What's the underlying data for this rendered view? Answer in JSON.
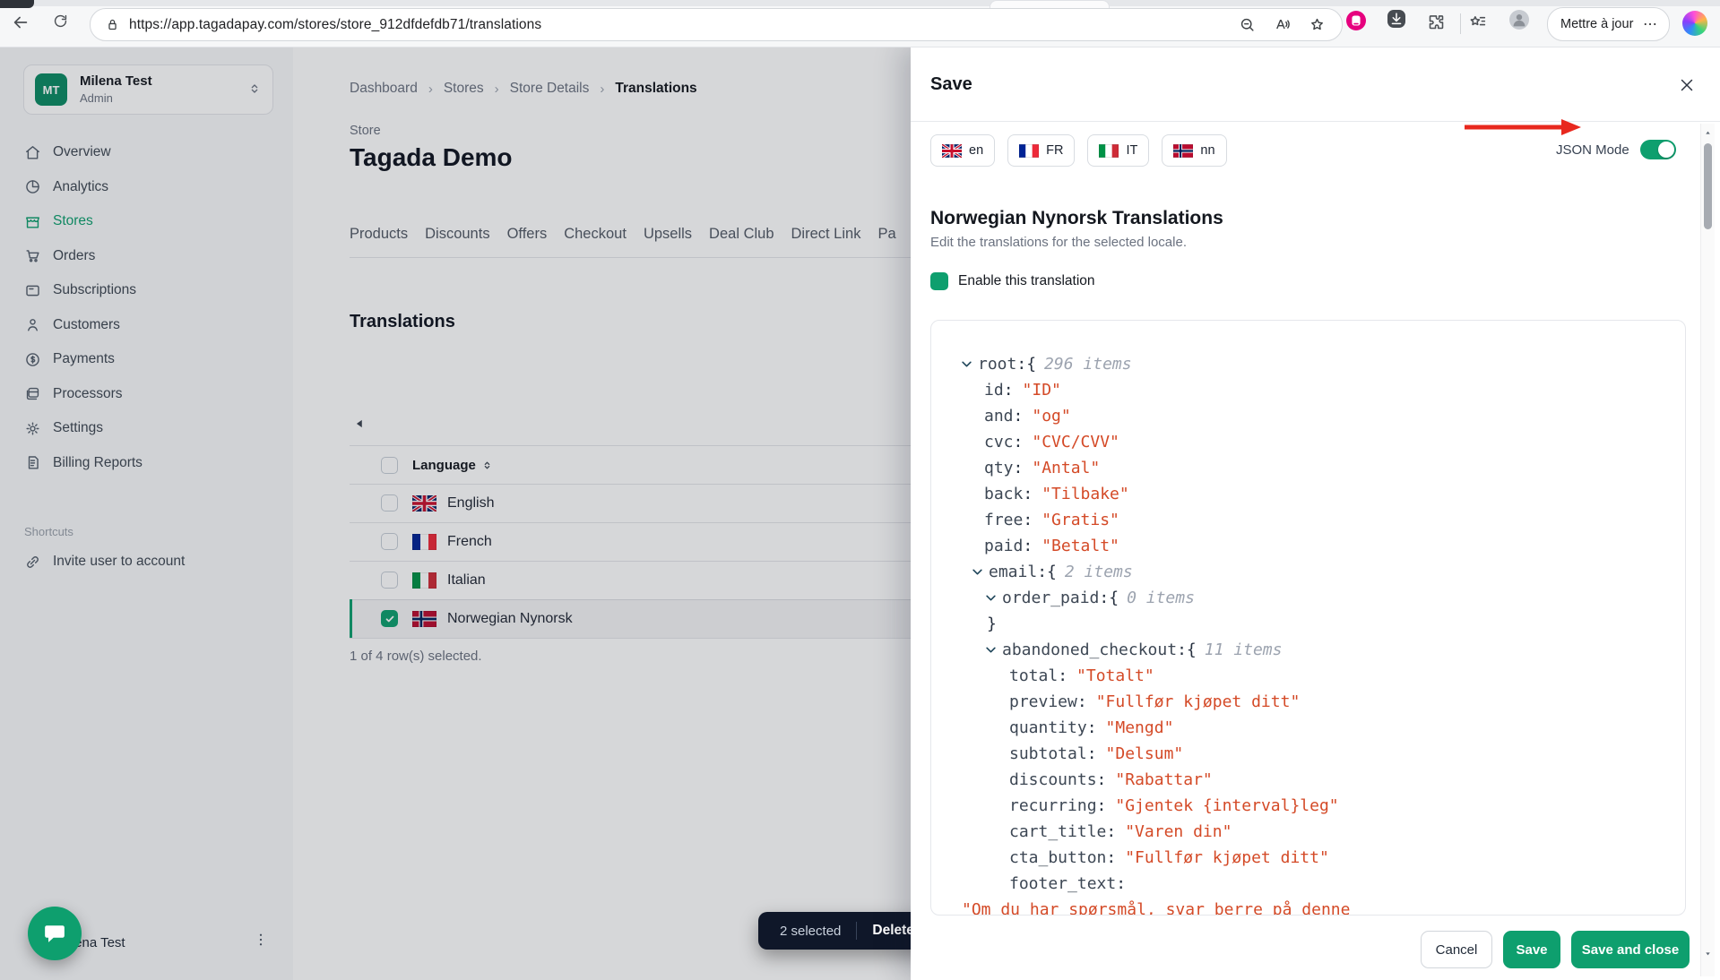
{
  "browser": {
    "url": "https://app.tagadapay.com/stores/store_912dfdefdb71/translations",
    "update_button": "Mettre à jour",
    "update_more": "…"
  },
  "sidebar": {
    "account": {
      "initials": "MT",
      "name": "Milena Test",
      "role": "Admin"
    },
    "nav": [
      {
        "icon": "home",
        "label": "Overview"
      },
      {
        "icon": "pie",
        "label": "Analytics"
      },
      {
        "icon": "store",
        "label": "Stores",
        "active": true
      },
      {
        "icon": "cart",
        "label": "Orders"
      },
      {
        "icon": "card",
        "label": "Subscriptions"
      },
      {
        "icon": "user",
        "label": "Customers"
      },
      {
        "icon": "dollar",
        "label": "Payments"
      },
      {
        "icon": "stack",
        "label": "Processors"
      },
      {
        "icon": "gear",
        "label": "Settings"
      },
      {
        "icon": "doc",
        "label": "Billing Reports"
      }
    ],
    "shortcuts_label": "Shortcuts",
    "shortcuts": [
      {
        "icon": "link",
        "label": "Invite user to account"
      }
    ],
    "footer_name": "Milena Test"
  },
  "main": {
    "breadcrumb": [
      "Dashboard",
      "Stores",
      "Store Details",
      "Translations"
    ],
    "store_label": "Store",
    "store_name": "Tagada Demo",
    "tabs": [
      "Products",
      "Discounts",
      "Offers",
      "Checkout",
      "Upsells",
      "Deal Club",
      "Direct Link",
      "Pa"
    ],
    "section_title": "Translations",
    "table": {
      "column": "Language",
      "rows": [
        {
          "flag": "uk",
          "label": "English",
          "checked": false,
          "selected": false
        },
        {
          "flag": "fr",
          "label": "French",
          "checked": false,
          "selected": false
        },
        {
          "flag": "it",
          "label": "Italian",
          "checked": false,
          "selected": false
        },
        {
          "flag": "no",
          "label": "Norwegian Nynorsk",
          "checked": true,
          "selected": true
        }
      ]
    },
    "selection_summary": "1 of 4 row(s) selected.",
    "toast": {
      "selected": "2 selected",
      "action": "Delete"
    }
  },
  "panel": {
    "title": "Save",
    "locales": [
      {
        "flag": "uk",
        "code": "en"
      },
      {
        "flag": "fr",
        "code": "FR"
      },
      {
        "flag": "it",
        "code": "IT"
      },
      {
        "flag": "no",
        "code": "nn"
      }
    ],
    "json_mode_label": "JSON Mode",
    "json_mode_on": true,
    "heading": "Norwegian Nynorsk Translations",
    "subheading": "Edit the translations for the selected locale.",
    "enable_label": "Enable this translation",
    "tree": [
      {
        "t": "open",
        "indent": 0,
        "key": "root",
        "count": "296 items"
      },
      {
        "t": "kv",
        "indent": 1,
        "key": "id",
        "value": "\"ID\""
      },
      {
        "t": "kv",
        "indent": 1,
        "key": "and",
        "value": "\"og\""
      },
      {
        "t": "kv",
        "indent": 1,
        "key": "cvc",
        "value": "\"CVC/CVV\""
      },
      {
        "t": "kv",
        "indent": 1,
        "key": "qty",
        "value": "\"Antal\""
      },
      {
        "t": "kv",
        "indent": 1,
        "key": "back",
        "value": "\"Tilbake\""
      },
      {
        "t": "kv",
        "indent": 1,
        "key": "free",
        "value": "\"Gratis\""
      },
      {
        "t": "kv",
        "indent": 1,
        "key": "paid",
        "value": "\"Betalt\""
      },
      {
        "t": "open",
        "indent": 1,
        "key": "email",
        "count": "2 items"
      },
      {
        "t": "open",
        "indent": 2,
        "key": "order_paid",
        "count": "0 items"
      },
      {
        "t": "close",
        "indent": 2
      },
      {
        "t": "open",
        "indent": 2,
        "key": "abandoned_checkout",
        "count": "11 items"
      },
      {
        "t": "kv",
        "indent": 3,
        "key": "total",
        "value": "\"Totalt\""
      },
      {
        "t": "kv",
        "indent": 3,
        "key": "preview",
        "value": "\"Fullfør kjøpet ditt\""
      },
      {
        "t": "kv",
        "indent": 3,
        "key": "quantity",
        "value": "\"Mengd\""
      },
      {
        "t": "kv",
        "indent": 3,
        "key": "subtotal",
        "value": "\"Delsum\""
      },
      {
        "t": "kv",
        "indent": 3,
        "key": "discounts",
        "value": "\"Rabattar\""
      },
      {
        "t": "kv",
        "indent": 3,
        "key": "recurring",
        "value": "\"Gjentek {interval}leg\""
      },
      {
        "t": "kv",
        "indent": 3,
        "key": "cart_title",
        "value": "\"Varen din\""
      },
      {
        "t": "kv",
        "indent": 3,
        "key": "cta_button",
        "value": "\"Fullfør kjøpet ditt\""
      },
      {
        "t": "kv",
        "indent": 3,
        "key": "footer_text",
        "value": ""
      },
      {
        "t": "cont",
        "indent": 0,
        "value": "\"Om du har spørsmål, svar berre på denne"
      }
    ],
    "footer": {
      "cancel": "Cancel",
      "save": "Save",
      "save_close": "Save and close"
    }
  },
  "colors": {
    "brand_green": "#0e9f6e",
    "json_value": "#d44a27",
    "toast_bg": "#0f1729",
    "arrow_red": "#e8281e"
  }
}
